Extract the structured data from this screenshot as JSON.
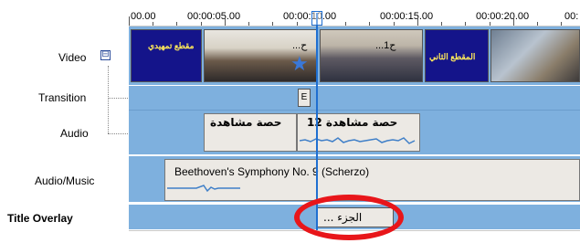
{
  "ruler": {
    "ticks": [
      "00.00",
      "00:00:05.00",
      "00:00:10.00",
      "00:00:15.00",
      "00:00:20.00",
      "00:"
    ]
  },
  "tracks": {
    "video": "Video",
    "transition": "Transition",
    "audio": "Audio",
    "music": "Audio/Music",
    "title": "Title Overlay",
    "expand_symbol": "⊟"
  },
  "video_clips": [
    {
      "caption": "",
      "title_text": "مقطع تمهيدي"
    },
    {
      "caption": "...ح"
    },
    {
      "caption": "...1ح"
    },
    {
      "caption": "",
      "title_text": "المقطع الثاني"
    },
    {
      "caption": ""
    }
  ],
  "audio_clips": [
    {
      "label": "حصة مشاهدة"
    },
    {
      "label": "1حصة مشاهدة 2"
    }
  ],
  "music_clip": {
    "label": "Beethoven's Symphony No. 9 (Scherzo)"
  },
  "title_clip": {
    "label": "... الجزء"
  },
  "transition_marker": "E",
  "colors": {
    "track_bg": "#7eb0de",
    "clip_bg": "#ece9e4",
    "playhead": "#1f6fd1",
    "highlight_circle": "#e8161a"
  }
}
